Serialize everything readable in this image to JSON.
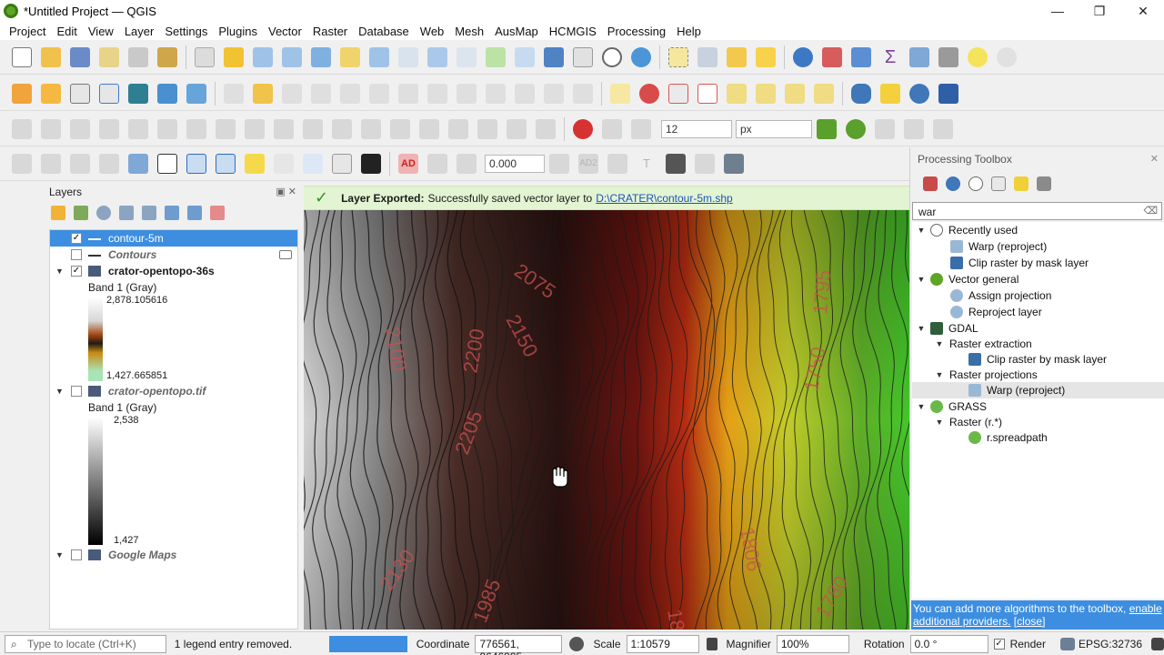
{
  "window": {
    "title": "*Untitled Project — QGIS",
    "controls": {
      "minimize": "—",
      "restore": "❐",
      "close": "✕"
    }
  },
  "menu": [
    "Project",
    "Edit",
    "View",
    "Layer",
    "Settings",
    "Plugins",
    "Vector",
    "Raster",
    "Database",
    "Web",
    "Mesh",
    "AusMap",
    "HCMGIS",
    "Processing",
    "Help"
  ],
  "toolbar": {
    "snapping_tolerance": "12",
    "snapping_units": "px",
    "label_rotation": "0.000",
    "label_toggle": "AD",
    "label_btn_ad2": "AD2",
    "label_btn_t": "T"
  },
  "message_bar": {
    "title": "Layer Exported:",
    "text": "Successfully saved vector layer to",
    "link": "D:\\CRATER\\contour-5m.shp"
  },
  "layers_panel": {
    "title": "Layers",
    "items": [
      {
        "name": "contour-5m",
        "checked": true
      },
      {
        "name": "Contours",
        "checked": false
      },
      {
        "name": "crator-opentopo-36s",
        "checked": true,
        "band": "Band 1 (Gray)",
        "max": "2,878.105616",
        "min": "1,427.665851"
      },
      {
        "name": "crator-opentopo.tif",
        "checked": false,
        "band": "Band 1 (Gray)",
        "max": "2,538",
        "min": "1,427"
      },
      {
        "name": "Google Maps",
        "checked": false
      }
    ]
  },
  "map": {
    "contour_labels": [
      "2075",
      "2150",
      "2200",
      "2205",
      "2100",
      "2130",
      "1985",
      "1795",
      "1750",
      "1806",
      "1780",
      "18"
    ]
  },
  "processing": {
    "title": "Processing Toolbox",
    "search_value": "war",
    "tree": [
      {
        "label": "Recently used",
        "level": 0
      },
      {
        "label": "Warp (reproject)",
        "level": 2
      },
      {
        "label": "Clip raster by mask layer",
        "level": 2
      },
      {
        "label": "Vector general",
        "level": 0
      },
      {
        "label": "Assign projection",
        "level": 2
      },
      {
        "label": "Reproject layer",
        "level": 2
      },
      {
        "label": "GDAL",
        "level": 0
      },
      {
        "label": "Raster extraction",
        "level": 1
      },
      {
        "label": "Clip raster by mask layer",
        "level": 3
      },
      {
        "label": "Raster projections",
        "level": 1
      },
      {
        "label": "Warp (reproject)",
        "level": 3
      },
      {
        "label": "GRASS",
        "level": 0
      },
      {
        "label": "Raster (r.*)",
        "level": 1
      },
      {
        "label": "r.spreadpath",
        "level": 3
      }
    ],
    "footer_text": "You can add more algorithms to the toolbox,",
    "footer_link": "enable additional providers.",
    "footer_close": "[close]"
  },
  "statusbar": {
    "locate_placeholder": "Type to locate (Ctrl+K)",
    "message": "1 legend entry removed.",
    "coordinate_label": "Coordinate",
    "coordinate": "776561, 9646995",
    "scale_label": "Scale",
    "scale": "1:10579",
    "magnifier_label": "Magnifier",
    "magnifier": "100%",
    "rotation_label": "Rotation",
    "rotation": "0.0 °",
    "render_label": "Render",
    "crs": "EPSG:32736"
  },
  "colors": {
    "accent": "#3d8ee0",
    "message_bg": "#e3f4d3",
    "qgis_green": "#5ea526"
  }
}
